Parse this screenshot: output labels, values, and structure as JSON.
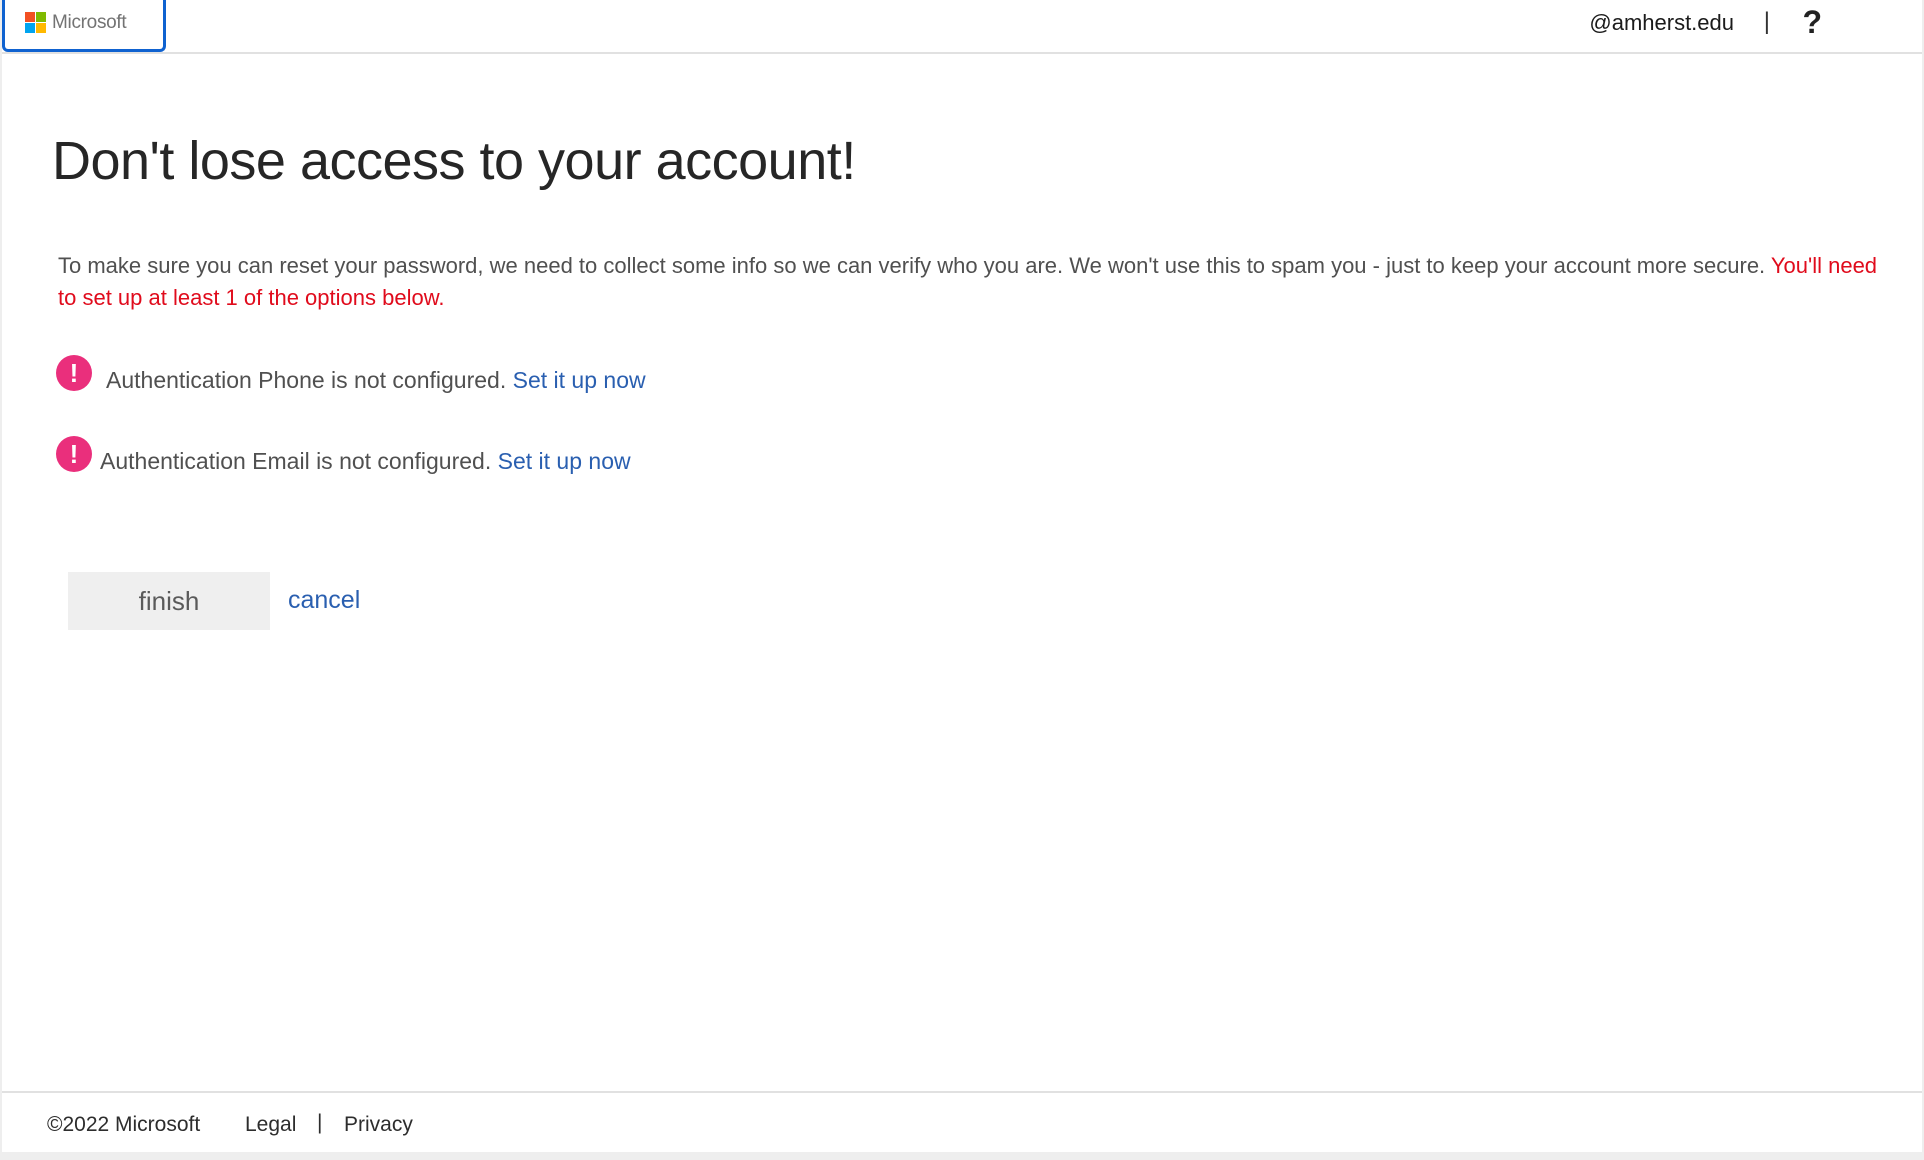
{
  "header": {
    "logo_text": "Microsoft",
    "logo_colors": [
      "#f25022",
      "#7fba00",
      "#00a4ef",
      "#ffb900"
    ],
    "user_id": "@amherst.edu",
    "separator": "|",
    "help_icon": "?"
  },
  "main": {
    "title": "Don't lose access to your account!",
    "intro_text": "To make sure you can reset your password, we need to collect some info so we can verify who you are. We won't use this to spam you - just to keep your account more secure. ",
    "intro_warning": "You'll need to set up at least 1 of the options below.",
    "methods": [
      {
        "icon": "!",
        "status_text": "Authentication Phone is not configured. ",
        "link_label": "Set it up now"
      },
      {
        "icon": "!",
        "status_text": "Authentication Email is not configured. ",
        "link_label": "Set it up now"
      }
    ],
    "finish_label": "finish",
    "cancel_label": "cancel"
  },
  "footer": {
    "copyright": "©2022 Microsoft",
    "legal": "Legal",
    "separator": "|",
    "privacy": "Privacy"
  },
  "colors": {
    "warning": "#e00b1c",
    "link": "#2a5fb0",
    "alert_icon": "#ea2f7c"
  }
}
